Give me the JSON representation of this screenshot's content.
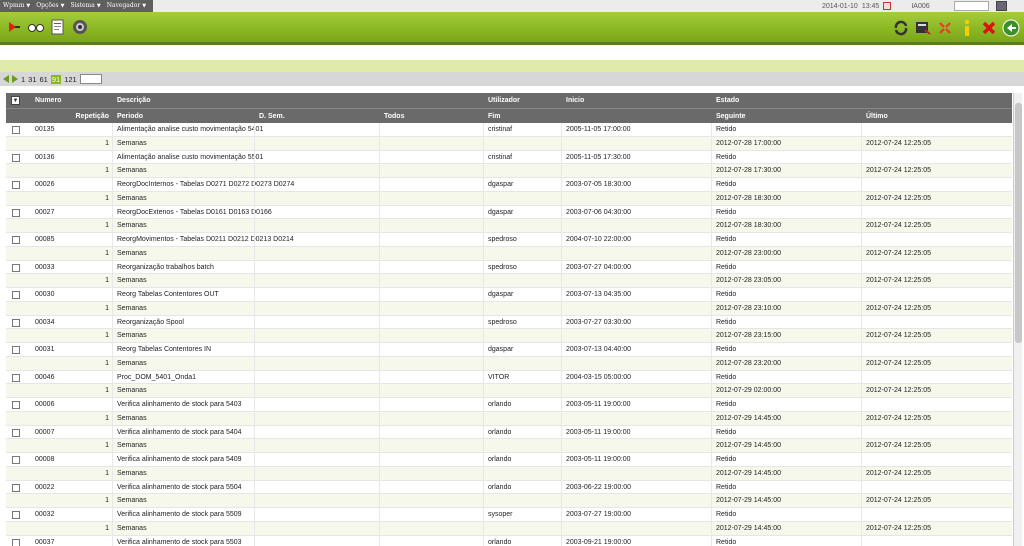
{
  "menubar": {
    "menus": [
      "Wpmm",
      "Opções",
      "Sistema",
      "Navegador"
    ],
    "date": "2014-01-10",
    "time": "13:45",
    "user": "IA006"
  },
  "pager": {
    "pages": [
      "1",
      "31",
      "61",
      "91",
      "121"
    ],
    "current": "91"
  },
  "table": {
    "header1": {
      "numero": "Numero",
      "descricao": "Descrição",
      "utilizador": "Utilizador",
      "inicio": "Inicio",
      "estado": "Estado"
    },
    "header2": {
      "repeticao": "Repetição",
      "periodo": "Periodo",
      "dsem": "D. Sem.",
      "todos": "Todos",
      "fim": "Fim",
      "seguinte": "Seguinte",
      "ultimo": "Último"
    },
    "records": [
      {
        "numero": "00135",
        "descricao": "Alimentação analise custo movimentação 5401",
        "utilizador": "cristinaf",
        "inicio": "2005-11-05  17:00:00",
        "estado": "Retido",
        "repeticao": "1",
        "periodo": "Semanas",
        "seguinte": "2012-07-28  17:00:00",
        "ultimo": "2012-07-24  12:25:05"
      },
      {
        "numero": "00136",
        "descricao": "Alimentação analise custo movimentação 5501",
        "utilizador": "cristinaf",
        "inicio": "2005-11-05  17:30:00",
        "estado": "Retido",
        "repeticao": "1",
        "periodo": "Semanas",
        "seguinte": "2012-07-28  17:30:00",
        "ultimo": "2012-07-24  12:25:05"
      },
      {
        "numero": "00026",
        "descricao": "ReorgDocInternos - Tabelas D0271 D0272 D0273 D0274",
        "utilizador": "dgaspar",
        "inicio": "2003-07-05  18:30:00",
        "estado": "Retido",
        "repeticao": "1",
        "periodo": "Semanas",
        "seguinte": "2012-07-28  18:30:00",
        "ultimo": "2012-07-24  12:25:05"
      },
      {
        "numero": "00027",
        "descricao": "ReorgDocExtenos - Tabelas D0161 D0163 D0166",
        "utilizador": "dgaspar",
        "inicio": "2003-07-06  04:30:00",
        "estado": "Retido",
        "repeticao": "1",
        "periodo": "Semanas",
        "seguinte": "2012-07-28  18:30:00",
        "ultimo": "2012-07-24  12:25:05"
      },
      {
        "numero": "00085",
        "descricao": "ReorgMovimentos - Tabelas D0211 D0212 D0213 D0214",
        "utilizador": "spedroso",
        "inicio": "2004-07-10  22:00:00",
        "estado": "Retido",
        "repeticao": "1",
        "periodo": "Semanas",
        "seguinte": "2012-07-28  23:00:00",
        "ultimo": "2012-07-24  12:25:05"
      },
      {
        "numero": "00033",
        "descricao": "Reorganização trabalhos batch",
        "utilizador": "spedroso",
        "inicio": "2003-07-27  04:00:00",
        "estado": "Retido",
        "repeticao": "1",
        "periodo": "Semanas",
        "seguinte": "2012-07-28  23:05:00",
        "ultimo": "2012-07-24  12:25:05"
      },
      {
        "numero": "00030",
        "descricao": "Reorg Tabelas Contentores OUT",
        "utilizador": "dgaspar",
        "inicio": "2003-07-13  04:35:00",
        "estado": "Retido",
        "repeticao": "1",
        "periodo": "Semanas",
        "seguinte": "2012-07-28  23:10:00",
        "ultimo": "2012-07-24  12:25:05"
      },
      {
        "numero": "00034",
        "descricao": "Reorganização Spool",
        "utilizador": "spedroso",
        "inicio": "2003-07-27  03:30:00",
        "estado": "Retido",
        "repeticao": "1",
        "periodo": "Semanas",
        "seguinte": "2012-07-28  23:15:00",
        "ultimo": "2012-07-24  12:25:05"
      },
      {
        "numero": "00031",
        "descricao": "Reorg Tabelas Contentores IN",
        "utilizador": "dgaspar",
        "inicio": "2003-07-13  04:40:00",
        "estado": "Retido",
        "repeticao": "1",
        "periodo": "Semanas",
        "seguinte": "2012-07-28  23:20:00",
        "ultimo": "2012-07-24  12:25:05"
      },
      {
        "numero": "00046",
        "descricao": "Proc_DOM_5401_Onda1",
        "utilizador": "VITOR",
        "inicio": "2004-03-15  05:00:00",
        "estado": "Retido",
        "repeticao": "1",
        "periodo": "Semanas",
        "seguinte": "2012-07-29  02:00:00",
        "ultimo": "2012-07-24  12:25:05"
      },
      {
        "numero": "00006",
        "descricao": "Verifica alinhamento de stock para 5403",
        "utilizador": "orlando",
        "inicio": "2003-05-11  19:00:00",
        "estado": "Retido",
        "repeticao": "1",
        "periodo": "Semanas",
        "seguinte": "2012-07-29  14:45:00",
        "ultimo": "2012-07-24  12:25:05"
      },
      {
        "numero": "00007",
        "descricao": "Verifica alinhamento de stock para 5404",
        "utilizador": "orlando",
        "inicio": "2003-05-11  19:00:00",
        "estado": "Retido",
        "repeticao": "1",
        "periodo": "Semanas",
        "seguinte": "2012-07-29  14:45:00",
        "ultimo": "2012-07-24  12:25:05"
      },
      {
        "numero": "00008",
        "descricao": "Verifica alinhamento de stock para 5409",
        "utilizador": "orlando",
        "inicio": "2003-05-11  19:00:00",
        "estado": "Retido",
        "repeticao": "1",
        "periodo": "Semanas",
        "seguinte": "2012-07-29  14:45:00",
        "ultimo": "2012-07-24  12:25:05"
      },
      {
        "numero": "00022",
        "descricao": "Verifica alinhamento de stock para 5504",
        "utilizador": "orlando",
        "inicio": "2003-06-22  19:00:00",
        "estado": "Retido",
        "repeticao": "1",
        "periodo": "Semanas",
        "seguinte": "2012-07-29  14:45:00",
        "ultimo": "2012-07-24  12:25:05"
      },
      {
        "numero": "00032",
        "descricao": "Verifica alinhamento de stock para 5509",
        "utilizador": "sysoper",
        "inicio": "2003-07-27  19:00:00",
        "estado": "Retido",
        "repeticao": "1",
        "periodo": "Semanas",
        "seguinte": "2012-07-29  14:45:00",
        "ultimo": "2012-07-24  12:25:05"
      },
      {
        "numero": "00037",
        "descricao": "Verifica alinhamento de stock para 5503",
        "utilizador": "orlando",
        "inicio": "2003-09-21  19:00:00",
        "estado": "Retido"
      }
    ]
  }
}
